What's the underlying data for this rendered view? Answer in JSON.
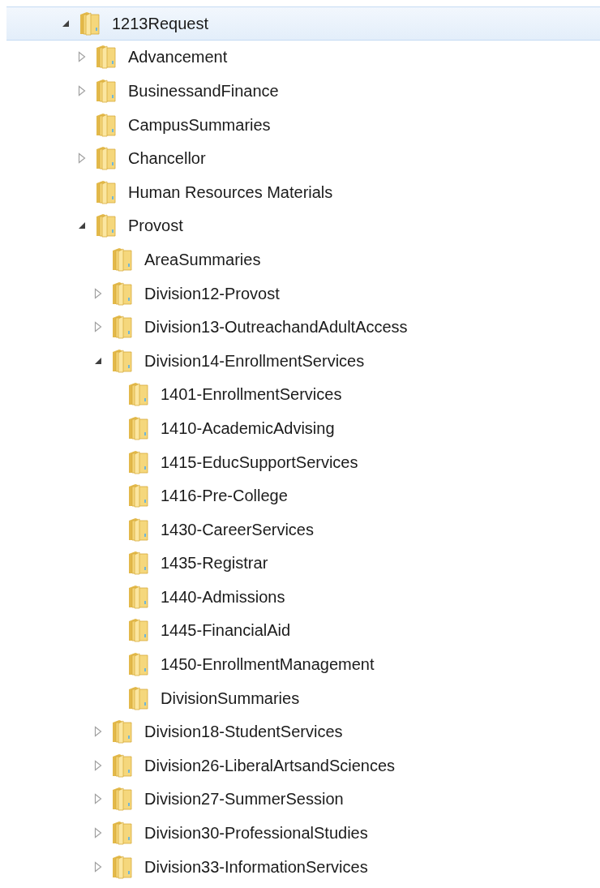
{
  "tree": [
    {
      "label": "1213Request",
      "expanded": true,
      "selected": true,
      "children": [
        {
          "label": "Advancement",
          "expanded": false,
          "selected": false
        },
        {
          "label": "BusinessandFinance",
          "expanded": false,
          "selected": false
        },
        {
          "label": "CampusSummaries",
          "selected": false
        },
        {
          "label": "Chancellor",
          "expanded": false,
          "selected": false
        },
        {
          "label": "Human Resources Materials",
          "selected": false
        },
        {
          "label": "Provost",
          "expanded": true,
          "selected": false,
          "children": [
            {
              "label": "AreaSummaries",
              "selected": false
            },
            {
              "label": "Division12-Provost",
              "expanded": false,
              "selected": false
            },
            {
              "label": "Division13-OutreachandAdultAccess",
              "expanded": false,
              "selected": false
            },
            {
              "label": "Division14-EnrollmentServices",
              "expanded": true,
              "selected": false,
              "children": [
                {
                  "label": "1401-EnrollmentServices",
                  "selected": false
                },
                {
                  "label": "1410-AcademicAdvising",
                  "selected": false
                },
                {
                  "label": "1415-EducSupportServices",
                  "selected": false
                },
                {
                  "label": "1416-Pre-College",
                  "selected": false
                },
                {
                  "label": "1430-CareerServices",
                  "selected": false
                },
                {
                  "label": "1435-Registrar",
                  "selected": false
                },
                {
                  "label": "1440-Admissions",
                  "selected": false
                },
                {
                  "label": "1445-FinancialAid",
                  "selected": false
                },
                {
                  "label": "1450-EnrollmentManagement",
                  "selected": false
                },
                {
                  "label": "DivisionSummaries",
                  "selected": false
                }
              ]
            },
            {
              "label": "Division18-StudentServices",
              "expanded": false,
              "selected": false
            },
            {
              "label": "Division26-LiberalArtsandSciences",
              "expanded": false,
              "selected": false
            },
            {
              "label": "Division27-SummerSession",
              "expanded": false,
              "selected": false
            },
            {
              "label": "Division30-ProfessionalStudies",
              "expanded": false,
              "selected": false
            },
            {
              "label": "Division33-InformationServices",
              "expanded": false,
              "selected": false
            }
          ]
        }
      ]
    }
  ]
}
